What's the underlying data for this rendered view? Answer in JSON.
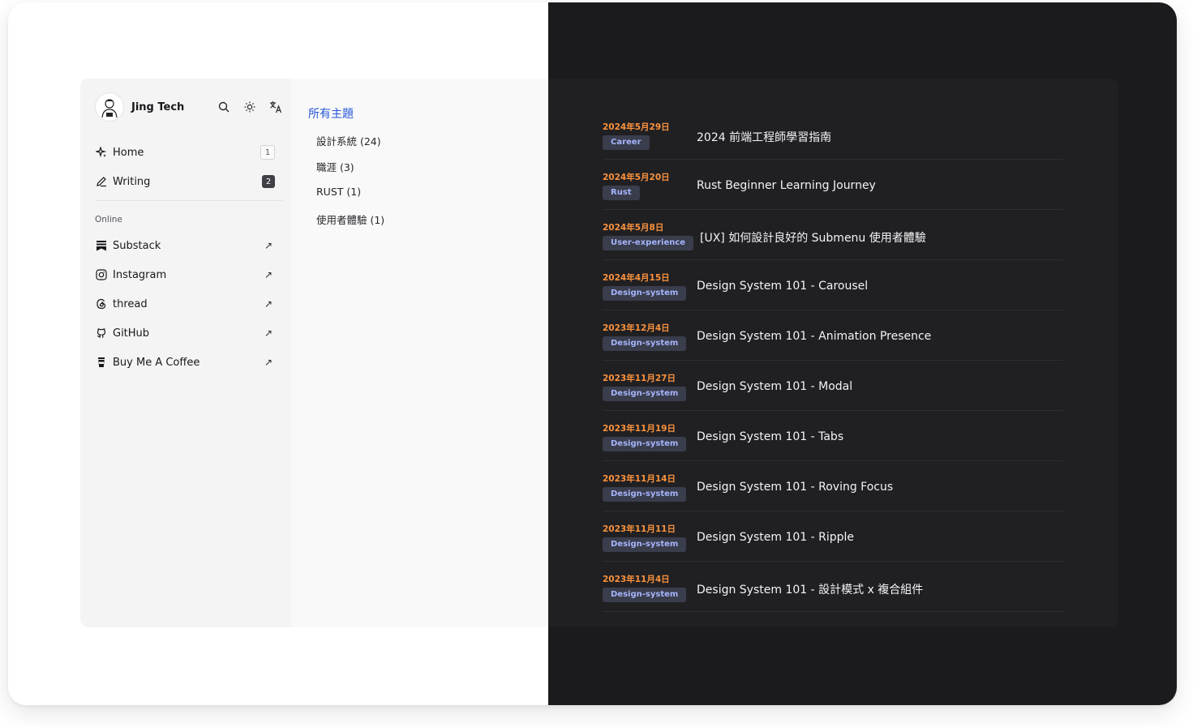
{
  "profile": {
    "name": "Jing Tech"
  },
  "nav": [
    {
      "label": "Home",
      "count": "1"
    },
    {
      "label": "Writing",
      "count": "2"
    }
  ],
  "online": {
    "label": "Online",
    "links": [
      {
        "label": "Substack",
        "icon": "substack-icon"
      },
      {
        "label": "Instagram",
        "icon": "instagram-icon"
      },
      {
        "label": "thread",
        "icon": "threads-icon"
      },
      {
        "label": "GitHub",
        "icon": "github-icon"
      },
      {
        "label": "Buy Me A Coffee",
        "icon": "coffee-icon"
      }
    ]
  },
  "topics": {
    "title": "所有主題",
    "items": [
      "設計系統 (24)",
      "職涯 (3)",
      "RUST (1)",
      "使用者體驗 (1)"
    ]
  },
  "posts": [
    {
      "date": "2024年5月29日",
      "tag": "Career",
      "title": "2024 前端工程師學習指南"
    },
    {
      "date": "2024年5月20日",
      "tag": "Rust",
      "title": "Rust Beginner Learning Journey"
    },
    {
      "date": "2024年5月8日",
      "tag": "User-experience",
      "title": "[UX] 如何設計良好的 Submenu 使用者體驗"
    },
    {
      "date": "2024年4月15日",
      "tag": "Design-system",
      "title": "Design System 101 - Carousel"
    },
    {
      "date": "2023年12月4日",
      "tag": "Design-system",
      "title": "Design System 101 - Animation Presence"
    },
    {
      "date": "2023年11月27日",
      "tag": "Design-system",
      "title": "Design System 101 - Modal"
    },
    {
      "date": "2023年11月19日",
      "tag": "Design-system",
      "title": "Design System 101 - Tabs"
    },
    {
      "date": "2023年11月14日",
      "tag": "Design-system",
      "title": "Design System 101 - Roving Focus"
    },
    {
      "date": "2023年11月11日",
      "tag": "Design-system",
      "title": "Design System 101 - Ripple"
    },
    {
      "date": "2023年11月4日",
      "tag": "Design-system",
      "title": "Design System 101 - 設計模式 x 複合組件"
    }
  ],
  "colors": {
    "accent": "#2557d6",
    "date": "#fb923c",
    "tag_text": "#a5b4fc",
    "tag_bg": "#3a3d4c"
  }
}
